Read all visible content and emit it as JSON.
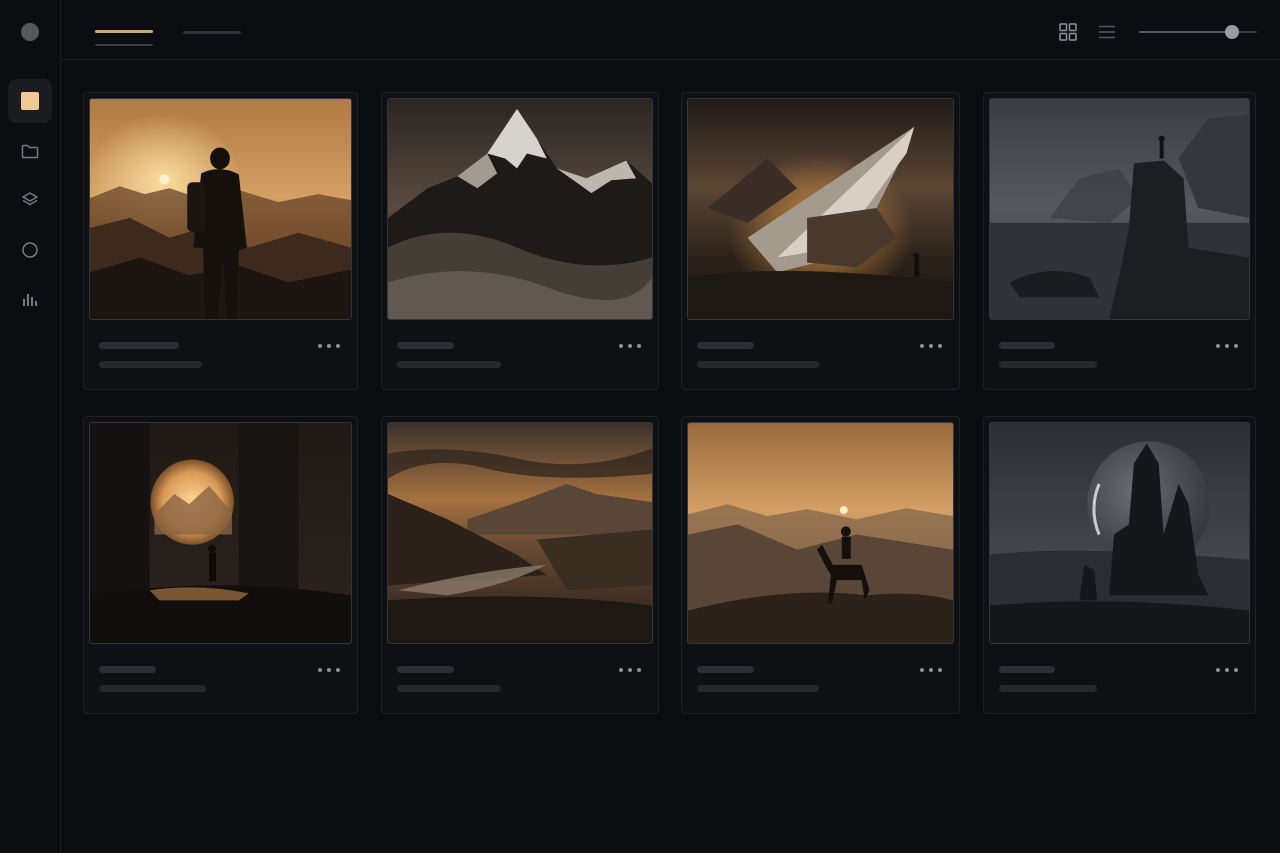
{
  "sidebar": {
    "items": [
      {
        "icon": "image-icon",
        "active": true
      },
      {
        "icon": "folder-icon",
        "active": false
      },
      {
        "icon": "layers-icon",
        "active": false
      },
      {
        "icon": "circle-icon",
        "active": false
      },
      {
        "icon": "bar-chart-icon",
        "active": false
      }
    ]
  },
  "toolbar": {
    "tabs": [
      {
        "active": true
      },
      {
        "active": false
      }
    ],
    "view_mode": "grid",
    "zoom_slider_value": 0.79
  },
  "colors": {
    "accent": "#cfa67a",
    "background": "#0c0d10",
    "card": "#0f1013"
  },
  "gallery": {
    "items": [
      {
        "scene": "hiker-at-sunset-overlooking-valley",
        "palette": "amber"
      },
      {
        "scene": "snowy-mountain-peak-above-clouds",
        "palette": "slate"
      },
      {
        "scene": "crashed-starship-wreck-with-fire",
        "palette": "amber-dark"
      },
      {
        "scene": "figure-on-sea-cliff",
        "palette": "cold-grey"
      },
      {
        "scene": "glowing-portal-in-ruins",
        "palette": "amber-dark"
      },
      {
        "scene": "river-valley-at-dusk",
        "palette": "amber"
      },
      {
        "scene": "horse-rider-on-hill-at-sunset",
        "palette": "amber"
      },
      {
        "scene": "dark-spires-under-planet",
        "palette": "cold-grey"
      }
    ]
  }
}
